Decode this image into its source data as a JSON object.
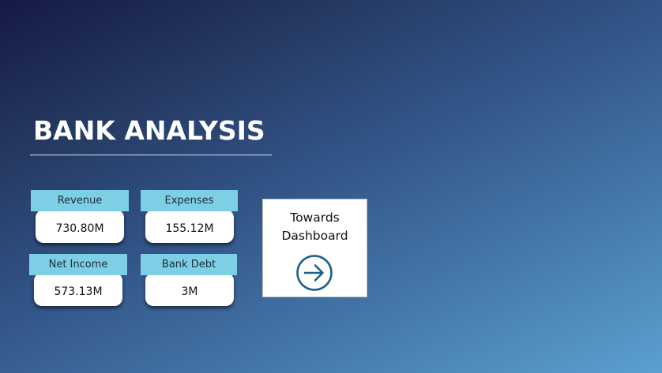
{
  "title": "BANK ANALYSIS",
  "kpis": [
    {
      "label": "Revenue",
      "value": "730.80M"
    },
    {
      "label": "Expenses",
      "value": "155.12M"
    },
    {
      "label": "Net Income",
      "value": "573.13M"
    },
    {
      "label": "Bank Debt",
      "value": "3M"
    }
  ],
  "nav_button": {
    "line1": "Towards",
    "line2": "Dashboard",
    "icon": "arrow-right-circle-icon"
  },
  "colors": {
    "label_bg": "#7ccfe5",
    "card_bg": "#ffffff",
    "icon": "#1f5f8b",
    "gradient_start": "#141a45",
    "gradient_end": "#5aa0d0"
  }
}
